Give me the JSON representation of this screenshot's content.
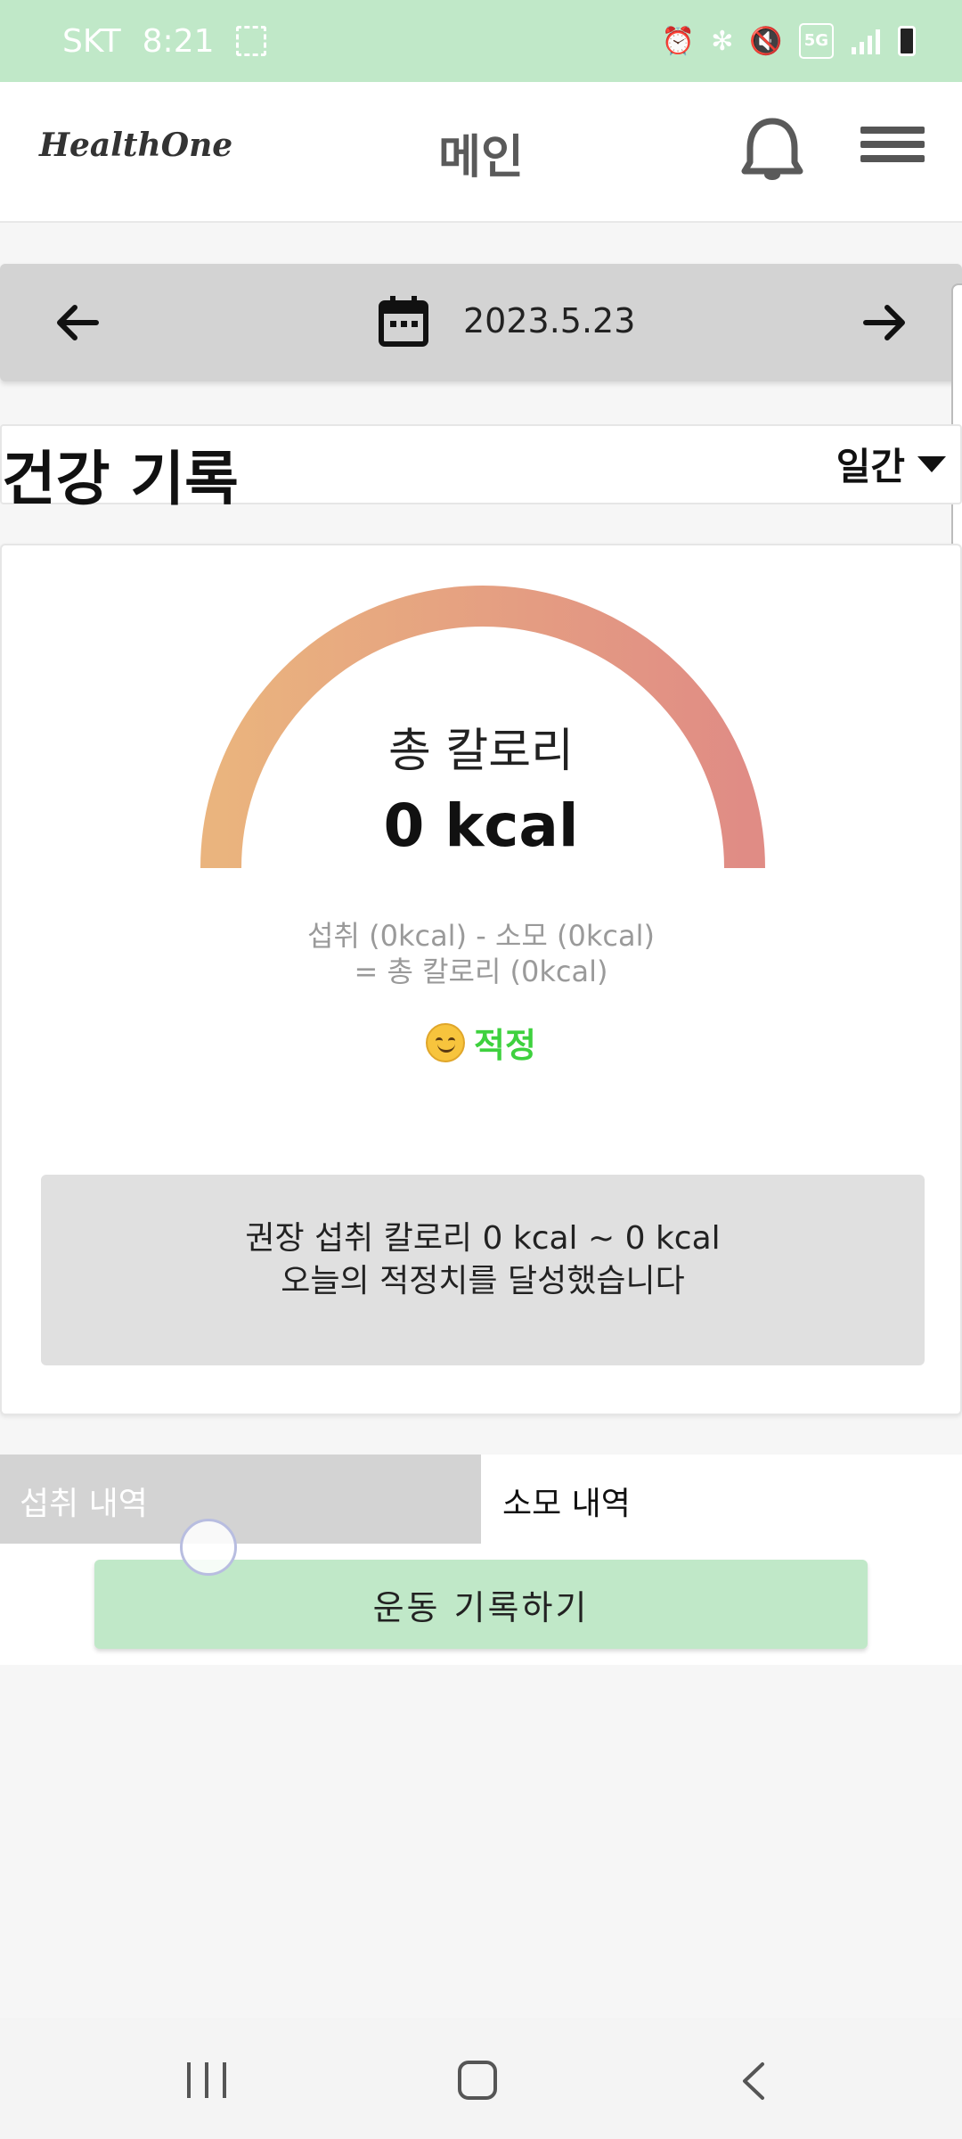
{
  "status_bar": {
    "carrier": "SKT",
    "time": "8:21",
    "network": "5G"
  },
  "header": {
    "logo": "HealthOne",
    "title": "메인"
  },
  "date_nav": {
    "date": "2023.5.23"
  },
  "record": {
    "title": "건강 기록",
    "period": "일간"
  },
  "calorie": {
    "label": "총 칼로리",
    "value": "0 kcal",
    "formula_line1": "섭취 (0kcal) - 소모 (0kcal)",
    "formula_line2": "= 총 칼로리 (0kcal)",
    "status": "적정",
    "recommend_line1": "권장 섭취 칼로리 0 kcal ~ 0 kcal",
    "recommend_line2": "오늘의 적정치를 달성했습니다"
  },
  "tabs": {
    "intake": "섭취 내역",
    "burn": "소모 내역"
  },
  "actions": {
    "record_exercise": "운동 기록하기"
  },
  "colors": {
    "accent_green": "#c0e8c8",
    "gauge_start": "#eab47e",
    "gauge_end": "#e08c85",
    "status_green": "#3ed13e"
  }
}
